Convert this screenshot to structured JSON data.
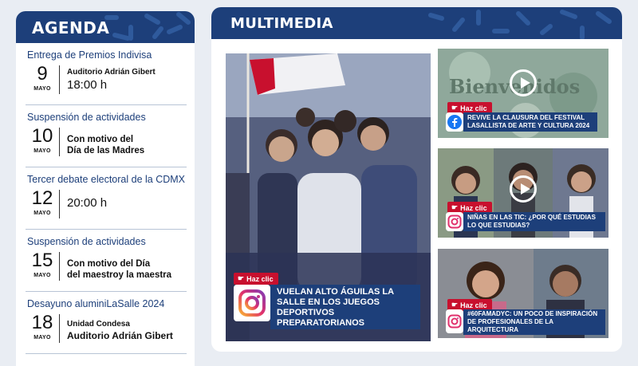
{
  "agenda": {
    "title": "AGENDA",
    "events": [
      {
        "title": "Entrega de Premios Indivisa",
        "day": "9",
        "month": "MAYO",
        "line1": "Auditorio Adrián Gibert",
        "line2": "18:00 h"
      },
      {
        "title": "Suspensión de actividades",
        "day": "10",
        "month": "MAYO",
        "line1": "Con motivo del",
        "line2": "Día de las Madres"
      },
      {
        "title": "Tercer debate electoral de la CDMX",
        "day": "12",
        "month": "MAYO",
        "line1": "20:00 h"
      },
      {
        "title": "Suspensión de actividades",
        "day": "15",
        "month": "MAYO",
        "line1": "Con motivo del Día",
        "line2": "del maestroy la maestra"
      },
      {
        "title": "Desayuno aluminiLaSalle 2024",
        "day": "18",
        "month": "MAYO",
        "line1": "Unidad Condesa",
        "line2": "Auditorio Adrián Gibert"
      }
    ]
  },
  "multimedia": {
    "title": "MULTIMEDIA",
    "feature": {
      "badge": "Haz clic",
      "caption": "VUELAN ALTO ÁGUILAS LA SALLE EN LOS JUEGOS DEPORTIVOS PREPARATORIANOS",
      "icon": "instagram-icon"
    },
    "side": [
      {
        "badge": "Haz clic",
        "caption": "REVIVE LA CLAUSURA DEL FESTIVAL LASALLISTA DE ARTE Y CULTURA 2024",
        "icon": "facebook-icon",
        "bg_text": "Bienvenidos"
      },
      {
        "badge": "Haz clic",
        "caption": "NIÑAS EN LAS TIC: ¿POR QUÉ ESTUDIAS LO QUE ESTUDIAS?",
        "icon": "instagram-icon"
      },
      {
        "badge": "Haz clic",
        "caption": "#60FAMADYC: UN POCO DE INSPIRACIÓN DE PROFESIONALES DE LA ARQUITECTURA",
        "icon": "instagram-icon"
      }
    ]
  },
  "colors": {
    "navy": "#1d3f7a",
    "red": "#c8102e",
    "bg": "#e9edf3"
  }
}
